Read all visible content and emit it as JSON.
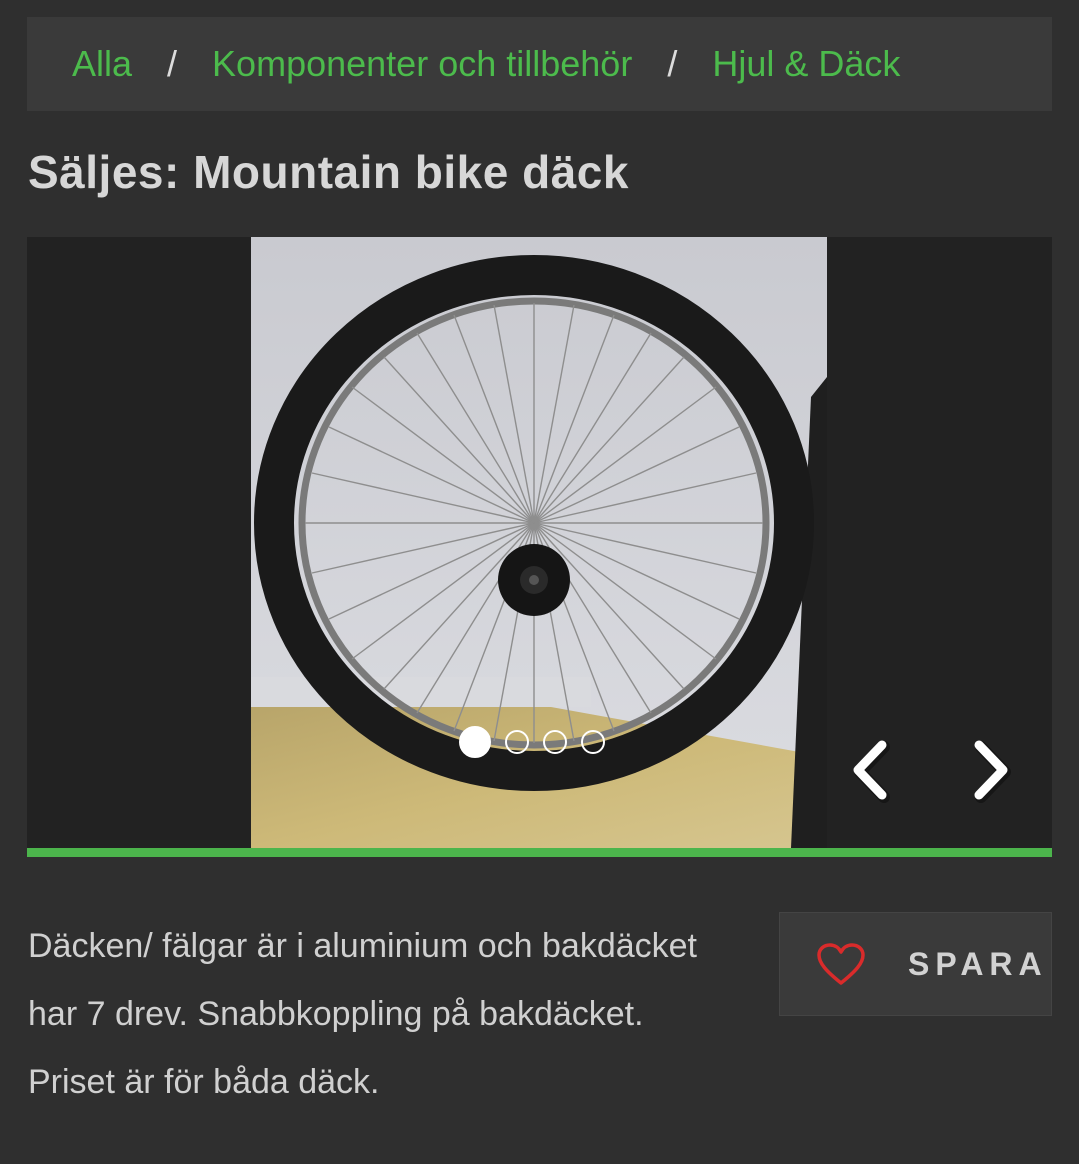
{
  "breadcrumb": {
    "items": [
      {
        "label": "Alla"
      },
      {
        "label": "Komponenter och tillbehör"
      },
      {
        "label": "Hjul & Däck"
      }
    ],
    "separator": "/"
  },
  "listing": {
    "title": "Säljes: Mountain bike däck",
    "description": "Däcken/ fälgar är i aluminium och bakdäcket har 7 drev. Snabbkoppling på bakdäcket. Priset är för båda däck."
  },
  "gallery": {
    "image_count": 4,
    "active_index": 1,
    "prev_icon": "chevron-left-icon",
    "next_icon": "chevron-right-icon"
  },
  "save_button": {
    "label": "SPARA",
    "icon": "heart-icon"
  },
  "colors": {
    "accent": "#4cb54c",
    "background": "#2f2f2f",
    "heart": "#d92b2b"
  }
}
